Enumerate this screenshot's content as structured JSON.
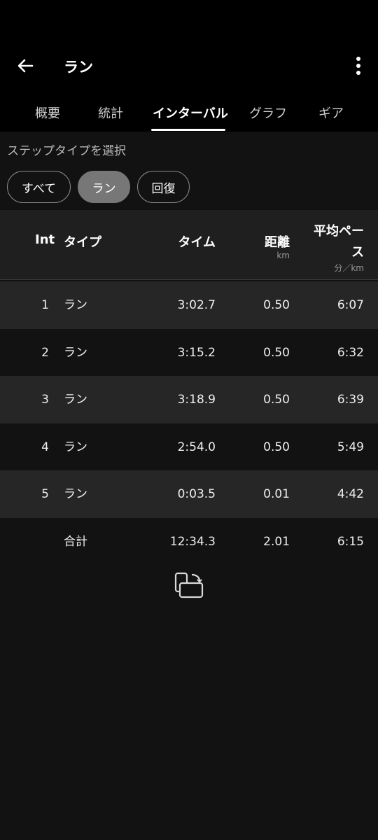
{
  "header": {
    "title": "ラン",
    "back_icon": "arrow-left-icon",
    "more_icon": "more-vert-icon"
  },
  "tabs": [
    {
      "label": "概要"
    },
    {
      "label": "統計"
    },
    {
      "label": "インターバル",
      "active": true
    },
    {
      "label": "グラフ"
    },
    {
      "label": "ギア"
    }
  ],
  "filter": {
    "title": "ステップタイプを選択",
    "chips": [
      {
        "label": "すべて"
      },
      {
        "label": "ラン",
        "selected": true
      },
      {
        "label": "回復"
      }
    ]
  },
  "table": {
    "headers": {
      "int": "Int",
      "type": "タイプ",
      "time": "タイム",
      "distance": "距離",
      "distance_unit": "km",
      "pace_line1": "平均ペー",
      "pace_line2": "ス",
      "pace_unit": "分／km"
    },
    "rows": [
      {
        "int": "1",
        "type": "ラン",
        "time": "3:02.7",
        "distance": "0.50",
        "pace": "6:07"
      },
      {
        "int": "2",
        "type": "ラン",
        "time": "3:15.2",
        "distance": "0.50",
        "pace": "6:32"
      },
      {
        "int": "3",
        "type": "ラン",
        "time": "3:18.9",
        "distance": "0.50",
        "pace": "6:39"
      },
      {
        "int": "4",
        "type": "ラン",
        "time": "2:54.0",
        "distance": "0.50",
        "pace": "5:49"
      },
      {
        "int": "5",
        "type": "ラン",
        "time": "0:03.5",
        "distance": "0.01",
        "pace": "4:42"
      }
    ],
    "total": {
      "label": "合計",
      "time": "12:34.3",
      "distance": "2.01",
      "pace": "6:15"
    }
  },
  "rotate_icon": "screen-rotation-icon"
}
